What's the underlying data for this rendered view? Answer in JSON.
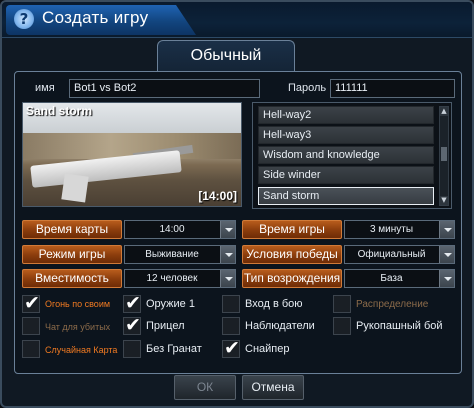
{
  "window": {
    "title": "Создать игру",
    "help_symbol": "?"
  },
  "mode_tab": {
    "label": "Обычный"
  },
  "name_field": {
    "label": "имя",
    "value": "Bot1 vs Bot2"
  },
  "password_field": {
    "label": "Пароль",
    "value": "111111"
  },
  "preview": {
    "map_name": "Sand storm",
    "time": "[14:00]"
  },
  "map_list": {
    "items": [
      "Hell-way2",
      "Hell-way3",
      "Wisdom and knowledge",
      "Side winder",
      "Sand storm"
    ],
    "selected": "Sand storm"
  },
  "options": {
    "map_time": {
      "label": "Время карты",
      "value": "14:00"
    },
    "game_time": {
      "label": "Время игры",
      "value": "3 минуты"
    },
    "game_mode": {
      "label": "Режим игры",
      "value": "Выживание"
    },
    "win_condition": {
      "label": "Условия победы",
      "value": "Официальный"
    },
    "capacity": {
      "label": "Вместимость",
      "value": "12 человек"
    },
    "respawn_type": {
      "label": "Тип возрождения",
      "value": "База"
    }
  },
  "checkboxes": {
    "friendly_fire": {
      "label": "Огонь по своим",
      "checked": true
    },
    "weapon1": {
      "label": "Оружие 1",
      "checked": true
    },
    "join_in_battle": {
      "label": "Вход в бою",
      "checked": false
    },
    "distribution": {
      "label": "Распределение",
      "checked": false
    },
    "dead_chat": {
      "label": "Чат для убитых",
      "checked": false
    },
    "crosshair": {
      "label": "Прицел",
      "checked": true
    },
    "observers": {
      "label": "Наблюдатели",
      "checked": false
    },
    "melee": {
      "label": "Рукопашный бой",
      "checked": false
    },
    "random_map": {
      "label": "Случайная Карта",
      "checked": false
    },
    "no_grenades": {
      "label": "Без Гранат",
      "checked": false
    },
    "sniper": {
      "label": "Снайпер",
      "checked": true
    }
  },
  "buttons": {
    "ok": "ОК",
    "cancel": "Отмена"
  },
  "colors": {
    "accent_orange": "#b85c1c",
    "title_blue": "#1f63b3"
  }
}
